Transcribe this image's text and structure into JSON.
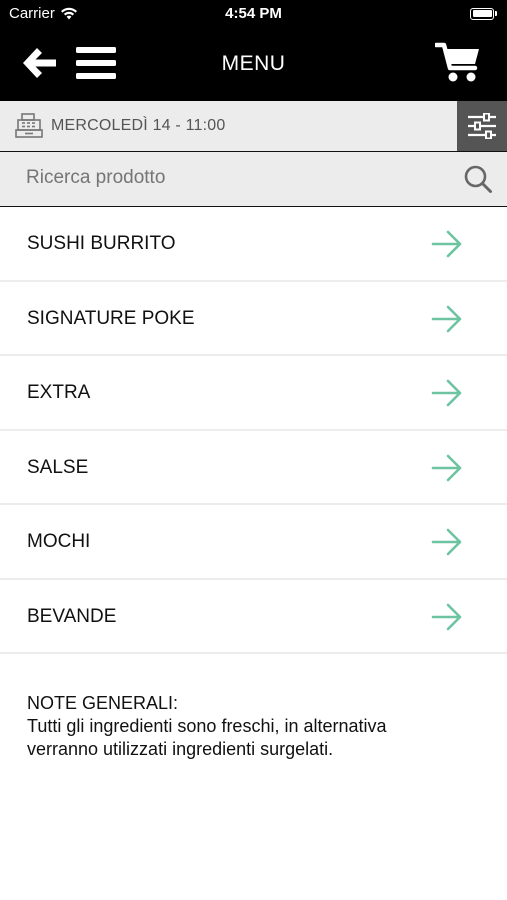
{
  "status_bar": {
    "carrier": "Carrier",
    "time": "4:54 PM"
  },
  "header": {
    "title": "MENU",
    "back_icon": "back-arrow-icon",
    "menu_icon": "hamburger-menu-icon",
    "cart_icon": "shopping-cart-icon"
  },
  "delivery": {
    "date_label": "MERCOLEDÌ 14 - 11:00",
    "icon": "cash-register-icon",
    "filter_icon": "sliders-filter-icon"
  },
  "search": {
    "placeholder": "Ricerca prodotto"
  },
  "categories": [
    {
      "label": "SUSHI BURRITO"
    },
    {
      "label": "SIGNATURE POKE"
    },
    {
      "label": "EXTRA"
    },
    {
      "label": "SALSE"
    },
    {
      "label": "MOCHI"
    },
    {
      "label": "BEVANDE"
    }
  ],
  "notes": {
    "heading": "NOTE GENERALI:",
    "line1": "Tutti gli ingredienti sono freschi, in alternativa",
    "line2": "verranno utilizzati ingredienti surgelati."
  },
  "colors": {
    "header_bg": "#000000",
    "accent_arrow": "#6cc4a1",
    "filter_bg": "#555555",
    "bar_bg": "#ececec"
  }
}
